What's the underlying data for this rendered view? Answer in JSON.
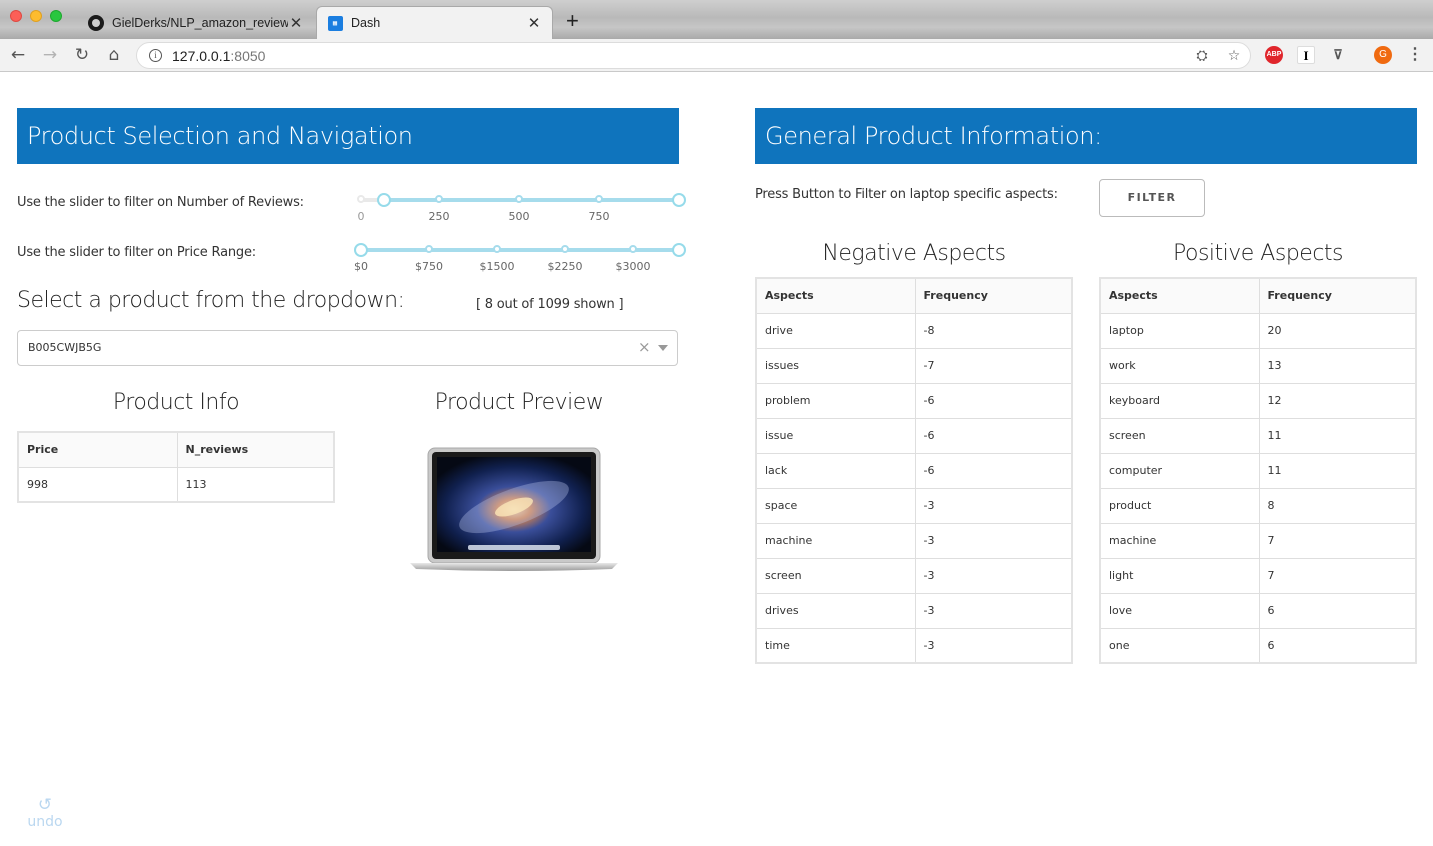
{
  "browser": {
    "tabs": [
      {
        "title": "GielDerks/NLP_amazon_review",
        "icon": "github-icon"
      },
      {
        "title": "Dash",
        "icon": "dash-icon"
      }
    ],
    "url_host": "127.0.0.1",
    "url_port": ":8050",
    "avatar_letter": "G",
    "abp_label": "ABP",
    "instapaper_label": "I"
  },
  "left_panel": {
    "banner": "Product Selection and Navigation",
    "reviews_slider": {
      "label": "Use the slider to filter on Number of Reviews:",
      "marks": [
        "0",
        "250",
        "500",
        "750"
      ],
      "selected_low": 30,
      "selected_high": 1000
    },
    "price_slider": {
      "label": "Use the slider to filter on Price Range:",
      "marks": [
        "$0",
        "$750",
        "$1500",
        "$2250",
        "$3000"
      ],
      "selected_low": 0,
      "selected_high": 3750
    },
    "dropdown_heading": "Select a product from the dropdown:",
    "shown_count": "[ 8 out of 1099 shown ]",
    "dropdown_value": "B005CWJB5G",
    "product_info": {
      "heading": "Product Info",
      "columns": [
        "Price",
        "N_reviews"
      ],
      "rows": [
        [
          "998",
          "113"
        ]
      ]
    },
    "product_preview": {
      "heading": "Product Preview"
    }
  },
  "right_panel": {
    "banner": "General Product Information:",
    "filter_prompt": "Press Button to Filter on laptop specific aspects:",
    "filter_button": "FILTER",
    "negative": {
      "heading": "Negative Aspects",
      "columns": [
        "Aspects",
        "Frequency"
      ],
      "rows": [
        [
          "drive",
          "-8"
        ],
        [
          "issues",
          "-7"
        ],
        [
          "problem",
          "-6"
        ],
        [
          "issue",
          "-6"
        ],
        [
          "lack",
          "-6"
        ],
        [
          "space",
          "-3"
        ],
        [
          "machine",
          "-3"
        ],
        [
          "screen",
          "-3"
        ],
        [
          "drives",
          "-3"
        ],
        [
          "time",
          "-3"
        ]
      ]
    },
    "positive": {
      "heading": "Positive Aspects",
      "columns": [
        "Aspects",
        "Frequency"
      ],
      "rows": [
        [
          "laptop",
          "20"
        ],
        [
          "work",
          "13"
        ],
        [
          "keyboard",
          "12"
        ],
        [
          "screen",
          "11"
        ],
        [
          "computer",
          "11"
        ],
        [
          "product",
          "8"
        ],
        [
          "machine",
          "7"
        ],
        [
          "light",
          "7"
        ],
        [
          "love",
          "6"
        ],
        [
          "one",
          "6"
        ]
      ]
    }
  },
  "undo": {
    "label": "undo",
    "icon": "undo-icon"
  }
}
